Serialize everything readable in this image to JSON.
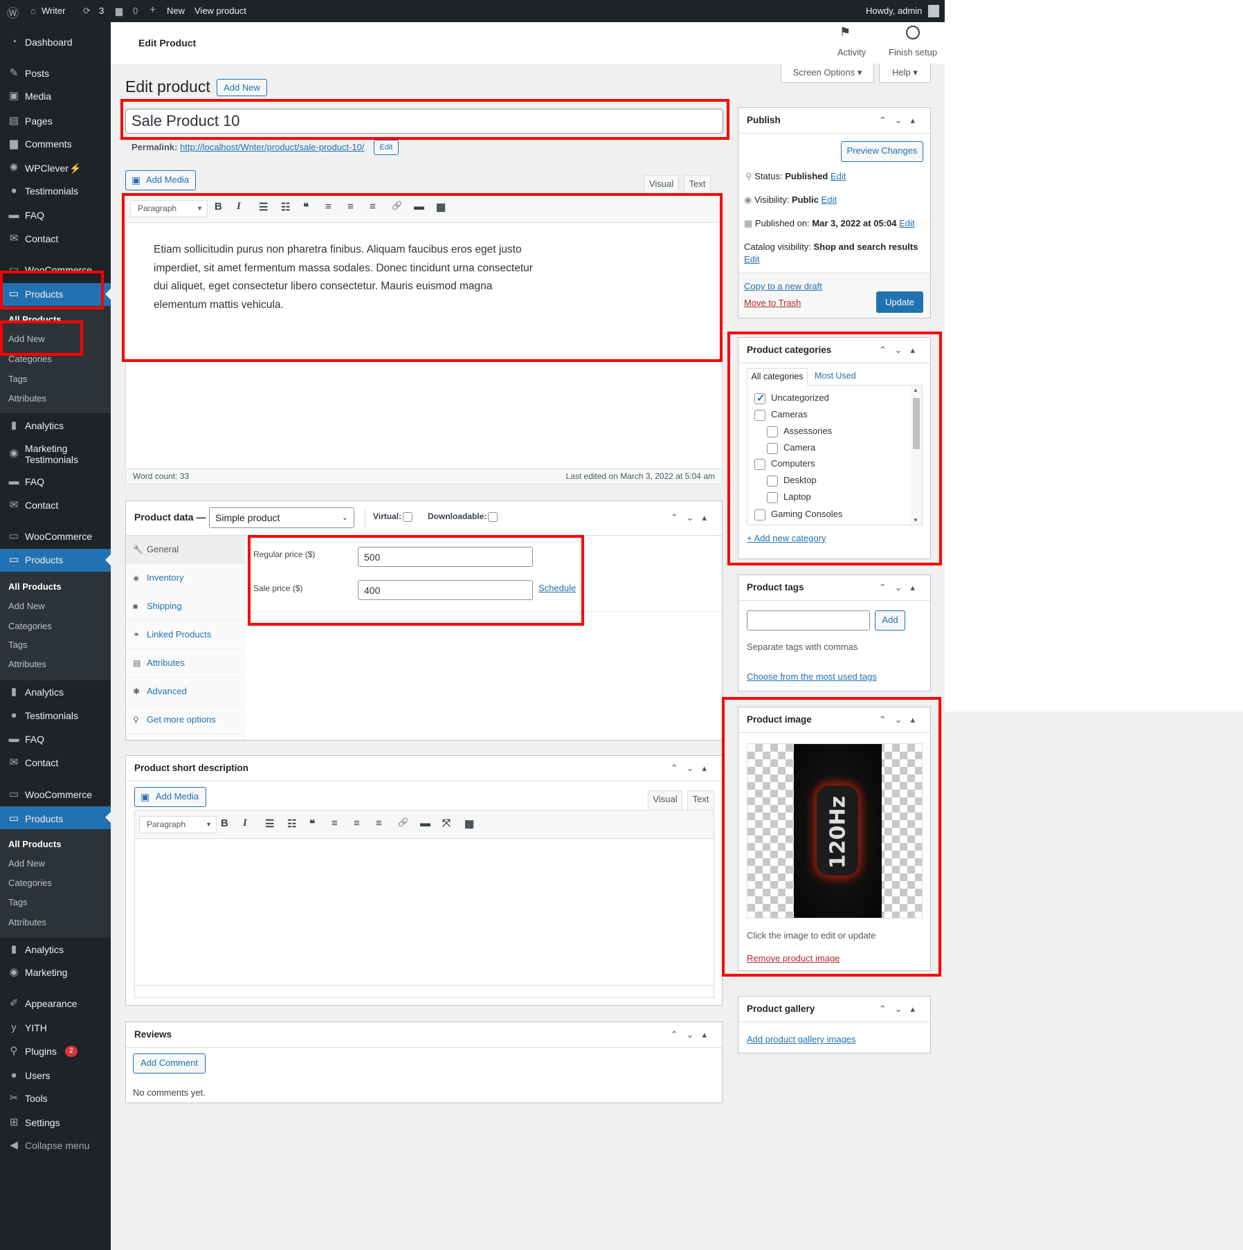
{
  "admin_bar": {
    "site_name": "Writer",
    "updates": "3",
    "comments": "0",
    "new_label": "New",
    "view_label": "View product",
    "howdy": "Howdy, admin"
  },
  "sidebar": {
    "items": [
      {
        "label": "Dashboard",
        "icon": "dashboard-icon",
        "glyph": "◔",
        "kind": "top"
      },
      {
        "label": "Posts",
        "icon": "pin-icon",
        "glyph": "✎",
        "kind": "top"
      },
      {
        "label": "Media",
        "icon": "media-icon",
        "glyph": "▣",
        "kind": "top"
      },
      {
        "label": "Pages",
        "icon": "pages-icon",
        "glyph": "▤",
        "kind": "top"
      },
      {
        "label": "Comments",
        "icon": "comment-icon",
        "glyph": "▆",
        "kind": "top"
      },
      {
        "label": "WPClever",
        "icon": "wpclever-icon",
        "glyph": "✺",
        "kind": "top",
        "extra": "⚡"
      },
      {
        "label": "Testimonials",
        "icon": "user-icon",
        "glyph": "●",
        "kind": "top"
      },
      {
        "label": "FAQ",
        "icon": "folder-icon",
        "glyph": "▬",
        "kind": "top"
      },
      {
        "label": "Contact",
        "icon": "mail-icon",
        "glyph": "✉",
        "kind": "top"
      },
      {
        "label": "WooCommerce",
        "icon": "woo-icon",
        "glyph": "▭",
        "kind": "top"
      },
      {
        "label": "Products",
        "icon": "products-icon",
        "glyph": "▭",
        "kind": "cur"
      },
      {
        "label": "All Products",
        "kind": "sub bold"
      },
      {
        "label": "Add New",
        "kind": "sub"
      },
      {
        "label": "Categories",
        "kind": "sub"
      },
      {
        "label": "Tags",
        "kind": "sub"
      },
      {
        "label": "Attributes",
        "kind": "sub"
      },
      {
        "label": "Analytics",
        "icon": "analytics-icon",
        "glyph": "▮",
        "kind": "top"
      },
      {
        "label": "Marketing Testimonials",
        "icon": "megaphone-icon",
        "glyph": "◉",
        "kind": "top"
      },
      {
        "label": "FAQ",
        "icon": "folder-icon",
        "glyph": "▬",
        "kind": "top"
      },
      {
        "label": "Contact",
        "icon": "mail-icon",
        "glyph": "✉",
        "kind": "top"
      },
      {
        "label": "WooCommerce",
        "icon": "woo-icon",
        "glyph": "▭",
        "kind": "top"
      },
      {
        "label": "Products",
        "icon": "products-icon",
        "glyph": "▭",
        "kind": "cur"
      },
      {
        "label": "All Products",
        "kind": "sub bold"
      },
      {
        "label": "Add New",
        "kind": "sub"
      },
      {
        "label": "Categories",
        "kind": "sub"
      },
      {
        "label": "Tags",
        "kind": "sub"
      },
      {
        "label": "Attributes",
        "kind": "sub"
      },
      {
        "label": "Analytics",
        "icon": "analytics-icon",
        "glyph": "▮",
        "kind": "top"
      },
      {
        "label": "Testimonials",
        "icon": "user-icon",
        "glyph": "●",
        "kind": "top"
      },
      {
        "label": "FAQ",
        "icon": "folder-icon",
        "glyph": "▬",
        "kind": "top"
      },
      {
        "label": "Contact",
        "icon": "mail-icon",
        "glyph": "✉",
        "kind": "top"
      },
      {
        "label": "WooCommerce",
        "icon": "woo-icon",
        "glyph": "▭",
        "kind": "top"
      },
      {
        "label": "Products",
        "icon": "products-icon",
        "glyph": "▭",
        "kind": "cur"
      },
      {
        "label": "All Products",
        "kind": "sub bold"
      },
      {
        "label": "Add New",
        "kind": "sub"
      },
      {
        "label": "Categories",
        "kind": "sub"
      },
      {
        "label": "Tags",
        "kind": "sub"
      },
      {
        "label": "Attributes",
        "kind": "sub"
      },
      {
        "label": "Analytics",
        "icon": "analytics-icon",
        "glyph": "▮",
        "kind": "top"
      },
      {
        "label": "Marketing",
        "icon": "megaphone-icon",
        "glyph": "◉",
        "kind": "top"
      },
      {
        "label": "Appearance",
        "icon": "brush-icon",
        "glyph": "✐",
        "kind": "top"
      },
      {
        "label": "YITH",
        "icon": "yith-icon",
        "glyph": "y",
        "kind": "top"
      },
      {
        "label": "Plugins",
        "icon": "plugin-icon",
        "glyph": "⚲",
        "kind": "top",
        "badge": "2"
      },
      {
        "label": "Users",
        "icon": "user-icon",
        "glyph": "●",
        "kind": "top"
      },
      {
        "label": "Tools",
        "icon": "wrench-icon",
        "glyph": "✂",
        "kind": "top"
      },
      {
        "label": "Settings",
        "icon": "settings-icon",
        "glyph": "⊞",
        "kind": "top"
      },
      {
        "label": "Collapse menu",
        "icon": "collapse-icon",
        "glyph": "◀",
        "kind": "top dim"
      }
    ]
  },
  "header": {
    "title": "Edit Product",
    "activity": "Activity",
    "finish_setup": "Finish setup",
    "screen_options": "Screen Options ▾",
    "help": "Help ▾"
  },
  "page": {
    "heading": "Edit product",
    "add_new": "Add New",
    "title_value": "Sale Product 10",
    "permalink_label": "Permalink:",
    "permalink_url": "http://localhost/Writer/product/sale-product-10/",
    "permalink_edit": "Edit"
  },
  "editor": {
    "add_media": "Add Media",
    "visual_tab": "Visual",
    "text_tab": "Text",
    "format": "Paragraph",
    "content_lines": [
      "Etiam sollicitudin purus non pharetra finibus. Aliquam faucibus eros eget justo",
      "imperdiet, sit amet fermentum massa sodales. Donec tincidunt urna consectetur",
      "dui aliquet, eget consectetur libero consectetur. Mauris euismod magna",
      "elementum mattis vehicula."
    ],
    "word_count": "Word count: 33",
    "last_edited": "Last edited on March 3, 2022 at 5:04 am"
  },
  "product_data": {
    "label": "Product data —",
    "type": "Simple product",
    "virtual": "Virtual:",
    "downloadable": "Downloadable:",
    "tabs": [
      {
        "label": "General",
        "icon": "wrench-icon"
      },
      {
        "label": "Inventory",
        "icon": "tag-icon"
      },
      {
        "label": "Shipping",
        "icon": "truck-icon"
      },
      {
        "label": "Linked Products",
        "icon": "link-icon"
      },
      {
        "label": "Attributes",
        "icon": "list-icon"
      },
      {
        "label": "Advanced",
        "icon": "gear-icon"
      },
      {
        "label": "Get more options",
        "icon": "plugin-icon"
      }
    ],
    "regular_price_label": "Regular price ($)",
    "regular_price": "500",
    "sale_price_label": "Sale price ($)",
    "sale_price": "400",
    "schedule": "Schedule"
  },
  "short_description": {
    "title": "Product short description",
    "add_media": "Add Media",
    "visual_tab": "Visual",
    "text_tab": "Text",
    "format": "Paragraph"
  },
  "reviews": {
    "title": "Reviews",
    "add_comment": "Add Comment",
    "empty": "No comments yet."
  },
  "publish": {
    "title": "Publish",
    "preview": "Preview Changes",
    "status_label": "Status:",
    "status": "Published",
    "visibility_label": "Visibility:",
    "visibility": "Public",
    "published_label": "Published on:",
    "published": "Mar 3, 2022 at 05:04",
    "catalog_label": "Catalog visibility:",
    "catalog": "Shop and search results",
    "edit": "Edit",
    "copy": "Copy to a new draft",
    "trash": "Move to Trash",
    "update": "Update"
  },
  "categories": {
    "title": "Product categories",
    "tab_all": "All categories",
    "tab_most": "Most Used",
    "items": [
      {
        "label": "Uncategorized",
        "checked": true,
        "child": false
      },
      {
        "label": "Cameras",
        "checked": false,
        "child": false
      },
      {
        "label": "Assessories",
        "checked": false,
        "child": true
      },
      {
        "label": "Camera",
        "checked": false,
        "child": true
      },
      {
        "label": "Computers",
        "checked": false,
        "child": false
      },
      {
        "label": "Desktop",
        "checked": false,
        "child": true
      },
      {
        "label": "Laptop",
        "checked": false,
        "child": true
      },
      {
        "label": "Gaming Consoles",
        "checked": false,
        "child": false
      }
    ],
    "add_new": "+ Add new category"
  },
  "tags": {
    "title": "Product tags",
    "input_value": "",
    "add": "Add",
    "hint": "Separate tags with commas",
    "choose": "Choose from the most used tags"
  },
  "product_image": {
    "title": "Product image",
    "image_text": "120Hz",
    "hint": "Click the image to edit or update",
    "remove": "Remove product image"
  },
  "gallery": {
    "title": "Product gallery",
    "add": "Add product gallery images"
  },
  "colors": {
    "accent": "#2271b1",
    "sidebar": "#1d2327",
    "highlight": "#ff0000",
    "danger": "#b32d2e"
  }
}
